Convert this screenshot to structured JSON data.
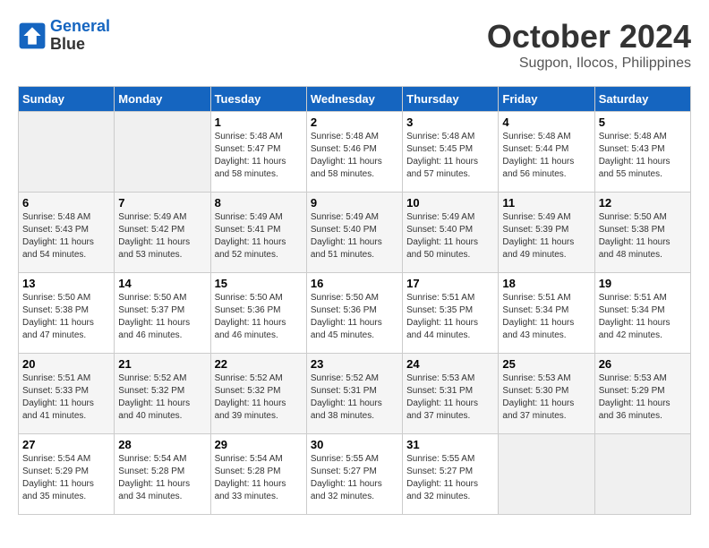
{
  "header": {
    "logo_line1": "General",
    "logo_line2": "Blue",
    "month": "October 2024",
    "location": "Sugpon, Ilocos, Philippines"
  },
  "days_of_week": [
    "Sunday",
    "Monday",
    "Tuesday",
    "Wednesday",
    "Thursday",
    "Friday",
    "Saturday"
  ],
  "weeks": [
    [
      {
        "day": "",
        "sunrise": "",
        "sunset": "",
        "daylight": ""
      },
      {
        "day": "",
        "sunrise": "",
        "sunset": "",
        "daylight": ""
      },
      {
        "day": "1",
        "sunrise": "Sunrise: 5:48 AM",
        "sunset": "Sunset: 5:47 PM",
        "daylight": "Daylight: 11 hours and 58 minutes."
      },
      {
        "day": "2",
        "sunrise": "Sunrise: 5:48 AM",
        "sunset": "Sunset: 5:46 PM",
        "daylight": "Daylight: 11 hours and 58 minutes."
      },
      {
        "day": "3",
        "sunrise": "Sunrise: 5:48 AM",
        "sunset": "Sunset: 5:45 PM",
        "daylight": "Daylight: 11 hours and 57 minutes."
      },
      {
        "day": "4",
        "sunrise": "Sunrise: 5:48 AM",
        "sunset": "Sunset: 5:44 PM",
        "daylight": "Daylight: 11 hours and 56 minutes."
      },
      {
        "day": "5",
        "sunrise": "Sunrise: 5:48 AM",
        "sunset": "Sunset: 5:43 PM",
        "daylight": "Daylight: 11 hours and 55 minutes."
      }
    ],
    [
      {
        "day": "6",
        "sunrise": "Sunrise: 5:48 AM",
        "sunset": "Sunset: 5:43 PM",
        "daylight": "Daylight: 11 hours and 54 minutes."
      },
      {
        "day": "7",
        "sunrise": "Sunrise: 5:49 AM",
        "sunset": "Sunset: 5:42 PM",
        "daylight": "Daylight: 11 hours and 53 minutes."
      },
      {
        "day": "8",
        "sunrise": "Sunrise: 5:49 AM",
        "sunset": "Sunset: 5:41 PM",
        "daylight": "Daylight: 11 hours and 52 minutes."
      },
      {
        "day": "9",
        "sunrise": "Sunrise: 5:49 AM",
        "sunset": "Sunset: 5:40 PM",
        "daylight": "Daylight: 11 hours and 51 minutes."
      },
      {
        "day": "10",
        "sunrise": "Sunrise: 5:49 AM",
        "sunset": "Sunset: 5:40 PM",
        "daylight": "Daylight: 11 hours and 50 minutes."
      },
      {
        "day": "11",
        "sunrise": "Sunrise: 5:49 AM",
        "sunset": "Sunset: 5:39 PM",
        "daylight": "Daylight: 11 hours and 49 minutes."
      },
      {
        "day": "12",
        "sunrise": "Sunrise: 5:50 AM",
        "sunset": "Sunset: 5:38 PM",
        "daylight": "Daylight: 11 hours and 48 minutes."
      }
    ],
    [
      {
        "day": "13",
        "sunrise": "Sunrise: 5:50 AM",
        "sunset": "Sunset: 5:38 PM",
        "daylight": "Daylight: 11 hours and 47 minutes."
      },
      {
        "day": "14",
        "sunrise": "Sunrise: 5:50 AM",
        "sunset": "Sunset: 5:37 PM",
        "daylight": "Daylight: 11 hours and 46 minutes."
      },
      {
        "day": "15",
        "sunrise": "Sunrise: 5:50 AM",
        "sunset": "Sunset: 5:36 PM",
        "daylight": "Daylight: 11 hours and 46 minutes."
      },
      {
        "day": "16",
        "sunrise": "Sunrise: 5:50 AM",
        "sunset": "Sunset: 5:36 PM",
        "daylight": "Daylight: 11 hours and 45 minutes."
      },
      {
        "day": "17",
        "sunrise": "Sunrise: 5:51 AM",
        "sunset": "Sunset: 5:35 PM",
        "daylight": "Daylight: 11 hours and 44 minutes."
      },
      {
        "day": "18",
        "sunrise": "Sunrise: 5:51 AM",
        "sunset": "Sunset: 5:34 PM",
        "daylight": "Daylight: 11 hours and 43 minutes."
      },
      {
        "day": "19",
        "sunrise": "Sunrise: 5:51 AM",
        "sunset": "Sunset: 5:34 PM",
        "daylight": "Daylight: 11 hours and 42 minutes."
      }
    ],
    [
      {
        "day": "20",
        "sunrise": "Sunrise: 5:51 AM",
        "sunset": "Sunset: 5:33 PM",
        "daylight": "Daylight: 11 hours and 41 minutes."
      },
      {
        "day": "21",
        "sunrise": "Sunrise: 5:52 AM",
        "sunset": "Sunset: 5:32 PM",
        "daylight": "Daylight: 11 hours and 40 minutes."
      },
      {
        "day": "22",
        "sunrise": "Sunrise: 5:52 AM",
        "sunset": "Sunset: 5:32 PM",
        "daylight": "Daylight: 11 hours and 39 minutes."
      },
      {
        "day": "23",
        "sunrise": "Sunrise: 5:52 AM",
        "sunset": "Sunset: 5:31 PM",
        "daylight": "Daylight: 11 hours and 38 minutes."
      },
      {
        "day": "24",
        "sunrise": "Sunrise: 5:53 AM",
        "sunset": "Sunset: 5:31 PM",
        "daylight": "Daylight: 11 hours and 37 minutes."
      },
      {
        "day": "25",
        "sunrise": "Sunrise: 5:53 AM",
        "sunset": "Sunset: 5:30 PM",
        "daylight": "Daylight: 11 hours and 37 minutes."
      },
      {
        "day": "26",
        "sunrise": "Sunrise: 5:53 AM",
        "sunset": "Sunset: 5:29 PM",
        "daylight": "Daylight: 11 hours and 36 minutes."
      }
    ],
    [
      {
        "day": "27",
        "sunrise": "Sunrise: 5:54 AM",
        "sunset": "Sunset: 5:29 PM",
        "daylight": "Daylight: 11 hours and 35 minutes."
      },
      {
        "day": "28",
        "sunrise": "Sunrise: 5:54 AM",
        "sunset": "Sunset: 5:28 PM",
        "daylight": "Daylight: 11 hours and 34 minutes."
      },
      {
        "day": "29",
        "sunrise": "Sunrise: 5:54 AM",
        "sunset": "Sunset: 5:28 PM",
        "daylight": "Daylight: 11 hours and 33 minutes."
      },
      {
        "day": "30",
        "sunrise": "Sunrise: 5:55 AM",
        "sunset": "Sunset: 5:27 PM",
        "daylight": "Daylight: 11 hours and 32 minutes."
      },
      {
        "day": "31",
        "sunrise": "Sunrise: 5:55 AM",
        "sunset": "Sunset: 5:27 PM",
        "daylight": "Daylight: 11 hours and 32 minutes."
      },
      {
        "day": "",
        "sunrise": "",
        "sunset": "",
        "daylight": ""
      },
      {
        "day": "",
        "sunrise": "",
        "sunset": "",
        "daylight": ""
      }
    ]
  ]
}
